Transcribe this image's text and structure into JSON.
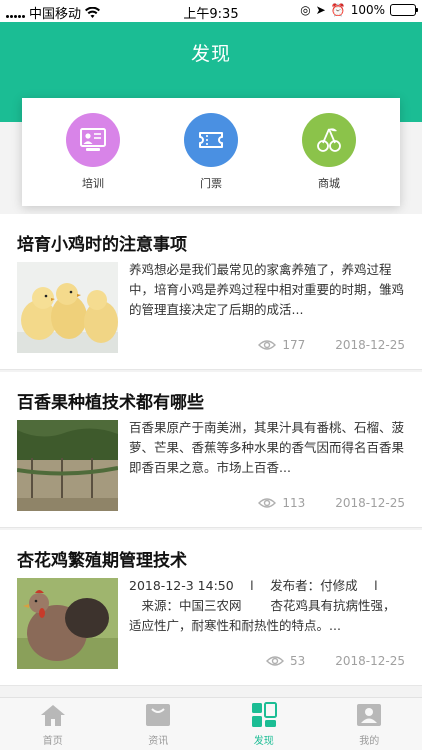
{
  "status_bar": {
    "carrier": "中国移动",
    "time": "上午9:35",
    "battery": "100%"
  },
  "header": {
    "title": "发现"
  },
  "quick_nav": [
    {
      "label": "培训",
      "icon": "training-icon",
      "color": "#d884e8"
    },
    {
      "label": "门票",
      "icon": "ticket-icon",
      "color": "#4a90e2"
    },
    {
      "label": "商城",
      "icon": "cherry-icon",
      "color": "#8bc34a"
    }
  ],
  "articles": [
    {
      "title": "培育小鸡时的注意事项",
      "summary": "养鸡想必是我们最常见的家禽养殖了，养鸡过程中，培育小鸡是养鸡过程中相对重要的时期，雏鸡的管理直接决定了后期的成活...",
      "views": "177",
      "date": "2018-12-25",
      "thumb": "chicks-photo"
    },
    {
      "title": "百香果种植技术都有哪些",
      "summary": "百香果原产于南美洲，其果汁具有番桃、石榴、菠萝、芒果、香蕉等多种水果的香气因而得名百香果即香百果之意。市场上百香...",
      "views": "113",
      "date": "2018-12-25",
      "thumb": "passionfruit-vine-photo"
    },
    {
      "title": "杏花鸡繁殖期管理技术",
      "summary": "2018-12-3 14:50 　l 　发布者：付修成 　l 　来源：中国三农网 　　杏花鸡具有抗病性强，适应性广，耐寒性和耐热性的特点。...",
      "views": "53",
      "date": "2018-12-25",
      "thumb": "hen-photo"
    }
  ],
  "tab_bar": [
    {
      "label": "首页",
      "icon": "home-icon",
      "active": false
    },
    {
      "label": "资讯",
      "icon": "news-icon",
      "active": false
    },
    {
      "label": "发现",
      "icon": "discover-icon",
      "active": true
    },
    {
      "label": "我的",
      "icon": "profile-icon",
      "active": false
    }
  ],
  "colors": {
    "brand": "#1bbd94",
    "tab_inactive": "#9a9a9a"
  }
}
